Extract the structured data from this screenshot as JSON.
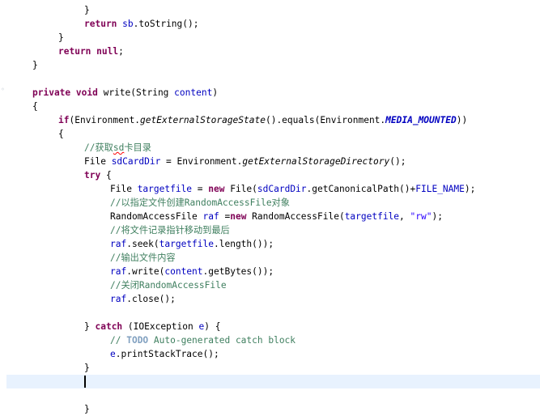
{
  "editor": {
    "colors": {
      "keyword": "#7f0055",
      "field": "#0000c0",
      "comment": "#3f7f5f",
      "todo": "#7f9fbf",
      "string": "#2a00ff",
      "current_line": "#e8f2fe"
    },
    "lines": [
      {
        "indent": 2,
        "tokens": [
          {
            "t": "text",
            "v": "}"
          }
        ]
      },
      {
        "indent": 2,
        "tokens": [
          {
            "t": "kw",
            "v": "return"
          },
          {
            "t": "text",
            "v": " "
          },
          {
            "t": "field",
            "v": "sb"
          },
          {
            "t": "text",
            "v": ".toString();"
          }
        ]
      },
      {
        "indent": 1,
        "tokens": [
          {
            "t": "text",
            "v": "}"
          }
        ]
      },
      {
        "indent": 1,
        "tokens": [
          {
            "t": "kw",
            "v": "return"
          },
          {
            "t": "text",
            "v": " "
          },
          {
            "t": "kw",
            "v": "null"
          },
          {
            "t": "text",
            "v": ";"
          }
        ]
      },
      {
        "indent": 0,
        "tokens": [
          {
            "t": "text",
            "v": "}"
          }
        ]
      },
      {
        "indent": 0,
        "tokens": []
      },
      {
        "indent": 0,
        "tokens": [
          {
            "t": "kw",
            "v": "private"
          },
          {
            "t": "text",
            "v": " "
          },
          {
            "t": "kw",
            "v": "void"
          },
          {
            "t": "text",
            "v": " write(String "
          },
          {
            "t": "field",
            "v": "content"
          },
          {
            "t": "text",
            "v": ")"
          }
        ]
      },
      {
        "indent": 0,
        "tokens": [
          {
            "t": "text",
            "v": "{"
          }
        ]
      },
      {
        "indent": 1,
        "tokens": [
          {
            "t": "kw",
            "v": "if"
          },
          {
            "t": "text",
            "v": "(Environment."
          },
          {
            "t": "smethod",
            "v": "getExternalStorageState"
          },
          {
            "t": "text",
            "v": "().equals(Environment."
          },
          {
            "t": "static",
            "v": "MEDIA_MOUNTED"
          },
          {
            "t": "text",
            "v": "))"
          }
        ]
      },
      {
        "indent": 1,
        "tokens": [
          {
            "t": "text",
            "v": "{"
          }
        ]
      },
      {
        "indent": 2,
        "tokens": [
          {
            "t": "comment",
            "v": "//获取"
          },
          {
            "t": "comment-typo",
            "v": "sd"
          },
          {
            "t": "comment",
            "v": "卡目录"
          }
        ]
      },
      {
        "indent": 2,
        "tokens": [
          {
            "t": "text",
            "v": "File "
          },
          {
            "t": "field",
            "v": "sdCardDir"
          },
          {
            "t": "text",
            "v": " = Environment."
          },
          {
            "t": "smethod",
            "v": "getExternalStorageDirectory"
          },
          {
            "t": "text",
            "v": "();"
          }
        ]
      },
      {
        "indent": 2,
        "tokens": [
          {
            "t": "kw",
            "v": "try"
          },
          {
            "t": "text",
            "v": " {"
          }
        ]
      },
      {
        "indent": 3,
        "tokens": [
          {
            "t": "text",
            "v": "File "
          },
          {
            "t": "field",
            "v": "targetfile"
          },
          {
            "t": "text",
            "v": " = "
          },
          {
            "t": "kw",
            "v": "new"
          },
          {
            "t": "text",
            "v": " File("
          },
          {
            "t": "field",
            "v": "sdCardDir"
          },
          {
            "t": "text",
            "v": ".getCanonicalPath()+"
          },
          {
            "t": "field",
            "v": "FILE_NAME"
          },
          {
            "t": "text",
            "v": ");"
          }
        ]
      },
      {
        "indent": 3,
        "tokens": [
          {
            "t": "comment",
            "v": "//以指定文件创建RandomAccessFile对象"
          }
        ]
      },
      {
        "indent": 3,
        "tokens": [
          {
            "t": "text",
            "v": "RandomAccessFile "
          },
          {
            "t": "field",
            "v": "raf"
          },
          {
            "t": "text",
            "v": " ="
          },
          {
            "t": "kw",
            "v": "new"
          },
          {
            "t": "text",
            "v": " RandomAccessFile("
          },
          {
            "t": "field",
            "v": "targetfile"
          },
          {
            "t": "text",
            "v": ", "
          },
          {
            "t": "string",
            "v": "\"rw\""
          },
          {
            "t": "text",
            "v": ");"
          }
        ]
      },
      {
        "indent": 3,
        "tokens": [
          {
            "t": "comment",
            "v": "//将文件记录指针移动到最后"
          }
        ]
      },
      {
        "indent": 3,
        "tokens": [
          {
            "t": "field",
            "v": "raf"
          },
          {
            "t": "text",
            "v": ".seek("
          },
          {
            "t": "field",
            "v": "targetfile"
          },
          {
            "t": "text",
            "v": ".length());"
          }
        ]
      },
      {
        "indent": 3,
        "tokens": [
          {
            "t": "comment",
            "v": "//输出文件内容"
          }
        ]
      },
      {
        "indent": 3,
        "tokens": [
          {
            "t": "field",
            "v": "raf"
          },
          {
            "t": "text",
            "v": ".write("
          },
          {
            "t": "field",
            "v": "content"
          },
          {
            "t": "text",
            "v": ".getBytes());"
          }
        ]
      },
      {
        "indent": 3,
        "tokens": [
          {
            "t": "comment",
            "v": "//关闭RandomAccessFile"
          }
        ]
      },
      {
        "indent": 3,
        "tokens": [
          {
            "t": "field",
            "v": "raf"
          },
          {
            "t": "text",
            "v": ".close();"
          }
        ]
      },
      {
        "indent": 0,
        "tokens": []
      },
      {
        "indent": 2,
        "tokens": [
          {
            "t": "text",
            "v": "} "
          },
          {
            "t": "kw",
            "v": "catch"
          },
          {
            "t": "text",
            "v": " (IOException "
          },
          {
            "t": "field",
            "v": "e"
          },
          {
            "t": "text",
            "v": ") {"
          }
        ]
      },
      {
        "indent": 3,
        "tokens": [
          {
            "t": "comment",
            "v": "// "
          },
          {
            "t": "todo",
            "v": "TODO"
          },
          {
            "t": "comment",
            "v": " Auto-generated catch block"
          }
        ]
      },
      {
        "indent": 3,
        "tokens": [
          {
            "t": "field",
            "v": "e"
          },
          {
            "t": "text",
            "v": ".printStackTrace();"
          }
        ]
      },
      {
        "indent": 2,
        "tokens": [
          {
            "t": "text",
            "v": "}"
          }
        ]
      },
      {
        "indent": 2,
        "tokens": [],
        "current": true,
        "caret": true
      },
      {
        "indent": 0,
        "tokens": []
      },
      {
        "indent": 2,
        "tokens": [
          {
            "t": "text",
            "v": "}"
          }
        ]
      }
    ]
  }
}
